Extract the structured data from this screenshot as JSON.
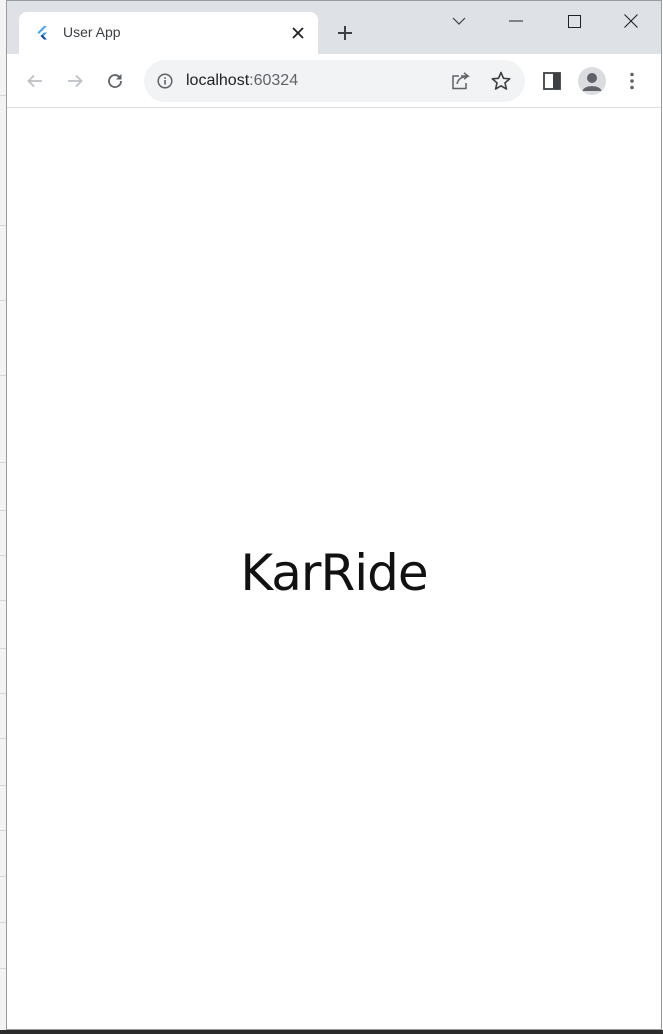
{
  "browser": {
    "tab": {
      "title": "User App",
      "favicon_icon": "flutter-logo-icon",
      "close_icon": "close-icon"
    },
    "new_tab_icon": "plus-icon",
    "window_controls": {
      "search_tabs_icon": "chevron-down-icon",
      "minimize_icon": "minimize-icon",
      "maximize_icon": "maximize-icon",
      "close_icon": "close-icon"
    },
    "toolbar": {
      "back_icon": "arrow-left-icon",
      "forward_icon": "arrow-right-icon",
      "reload_icon": "reload-icon",
      "site_info_icon": "info-icon",
      "url_host": "localhost",
      "url_port": ":60324",
      "share_icon": "share-icon",
      "bookmark_icon": "star-icon",
      "side_panel_icon": "side-panel-icon",
      "profile_icon": "person-icon",
      "menu_icon": "kebab-menu-icon"
    }
  },
  "page": {
    "title": "KarRide"
  },
  "colors": {
    "tabstrip_bg": "#dee1e6",
    "omnibox_bg": "#f1f3f4",
    "icon_gray": "#5f6368",
    "flutter_blue": "#42a5f5"
  }
}
